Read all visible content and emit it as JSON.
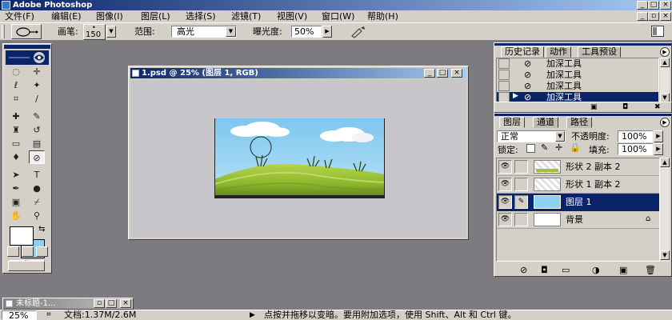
{
  "app": {
    "title": "Adobe Photoshop"
  },
  "menu": [
    "文件(F)",
    "编辑(E)",
    "图像(I)",
    "图层(L)",
    "选择(S)",
    "滤镜(T)",
    "视图(V)",
    "窗口(W)",
    "帮助(H)"
  ],
  "options": {
    "brush_label": "画笔:",
    "brush_size": "150",
    "range_label": "范围:",
    "range_value": "高光",
    "exposure_label": "曝光度:",
    "exposure_value": "50%"
  },
  "document": {
    "title": "1.psd @ 25% (图层 1, RGB)"
  },
  "history_panel": {
    "tabs": [
      "历史记录",
      "动作",
      "工具预设"
    ],
    "items": [
      "加深工具",
      "加深工具",
      "加深工具",
      "加深工具"
    ],
    "selected_index": 3
  },
  "layers_panel": {
    "tabs": [
      "图层",
      "通道",
      "路径"
    ],
    "blend_mode": "正常",
    "opacity_label": "不透明度:",
    "opacity_value": "100%",
    "lock_label": "锁定:",
    "fill_label": "填充:",
    "fill_value": "100%",
    "layers": [
      {
        "name": "形状 2 副本 2",
        "selected": false
      },
      {
        "name": "形状 1 副本 2",
        "selected": false
      },
      {
        "name": "图层 1",
        "selected": true
      },
      {
        "name": "背景",
        "selected": false
      }
    ]
  },
  "minimized_window": {
    "title": "未标题-1..."
  },
  "status": {
    "zoom": "25%",
    "doc_info": "文档:1.37M/2.6M",
    "hint": "点按并拖移以变暗。要用附加选项，使用 Shift、Alt 和 Ctrl 键。"
  },
  "colors": {
    "accent": "#0a246a",
    "sky": "#8ccdf0",
    "grass": "#9ec33a",
    "bg_swatch": "#8fd1f2"
  }
}
